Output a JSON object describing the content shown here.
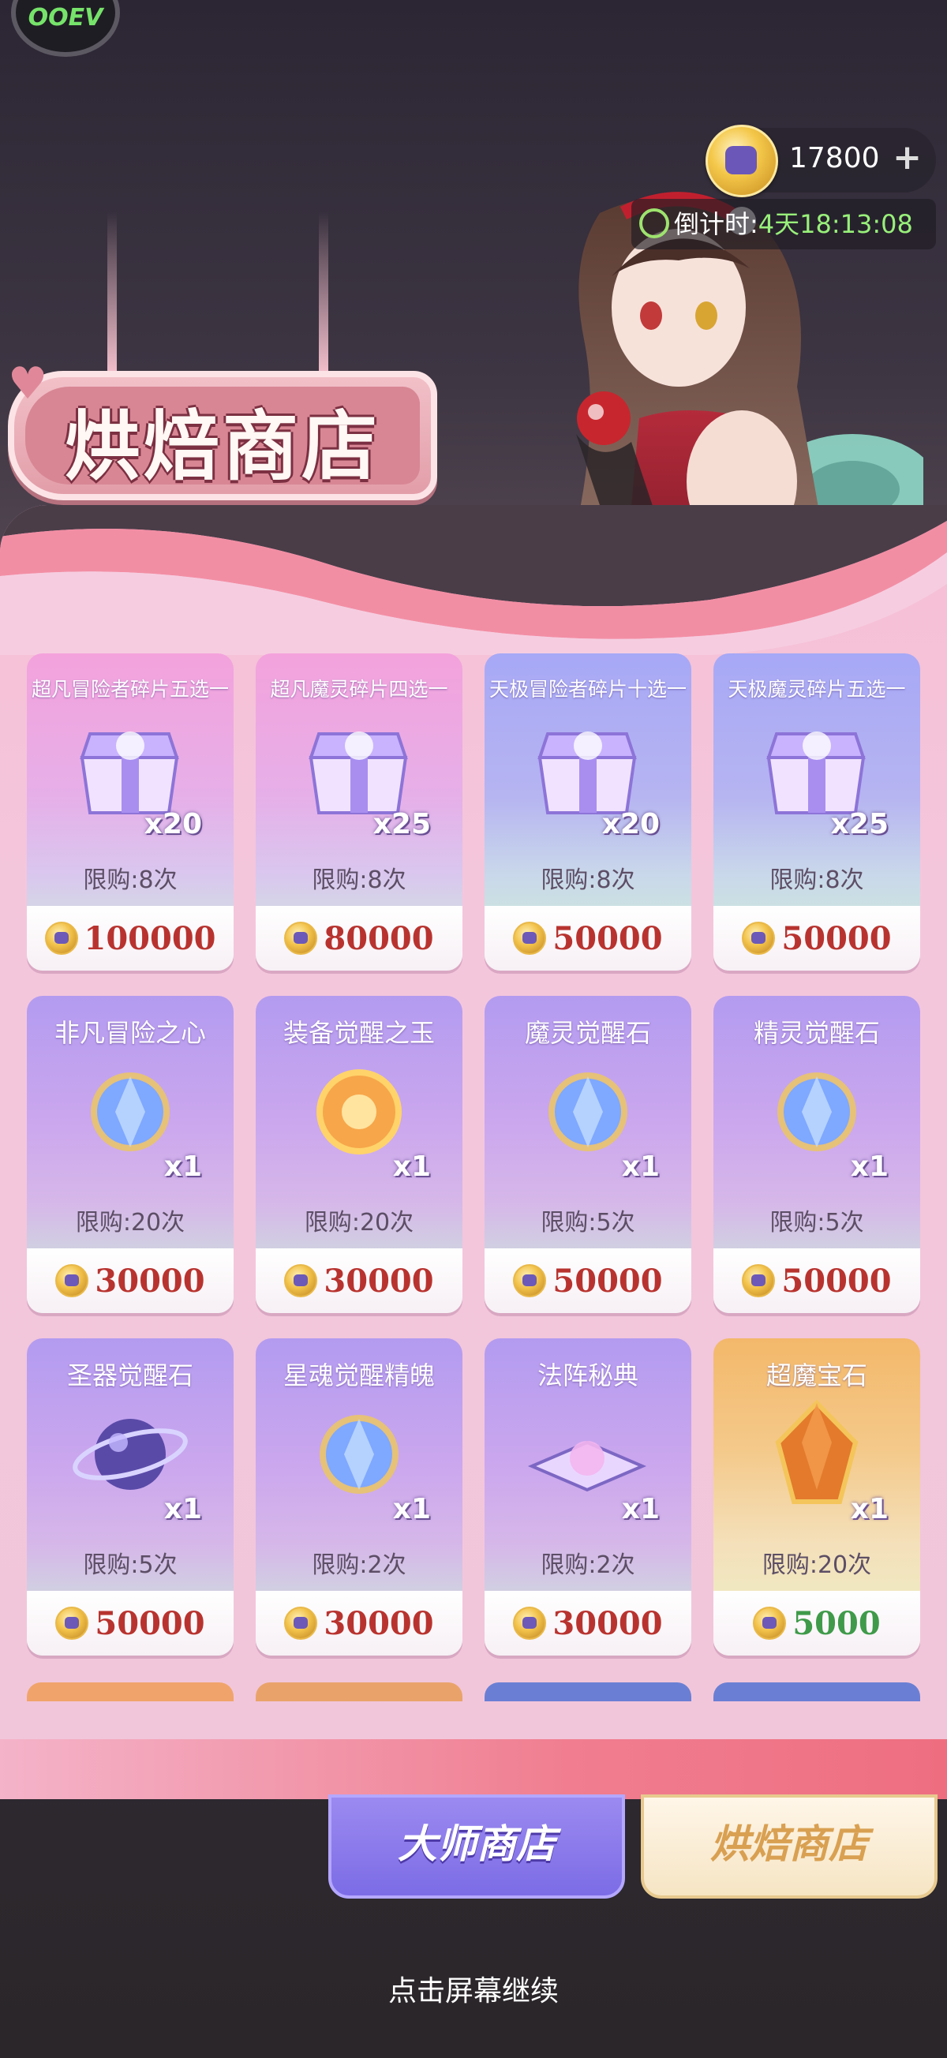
{
  "top_badge": {
    "label": "OOEV"
  },
  "currency": {
    "amount": "17800",
    "plus": "+",
    "icon": "coin-icon"
  },
  "countdown": {
    "label": "倒计时:",
    "value": "4天18:13:08"
  },
  "shop_sign": {
    "title": "烘焙商店"
  },
  "items": [
    {
      "name": "超凡冒险者碎片五选一",
      "qty": "x20",
      "limit": "限购:8次",
      "price": "100000",
      "style": "pink"
    },
    {
      "name": "超凡魔灵碎片四选一",
      "qty": "x25",
      "limit": "限购:8次",
      "price": "80000",
      "style": "pink"
    },
    {
      "name": "天极冒险者碎片十选一",
      "qty": "x20",
      "limit": "限购:8次",
      "price": "50000",
      "style": "blue"
    },
    {
      "name": "天极魔灵碎片五选一",
      "qty": "x25",
      "limit": "限购:8次",
      "price": "50000",
      "style": "blue"
    },
    {
      "name": "非凡冒险之心",
      "qty": "x1",
      "limit": "限购:20次",
      "price": "30000",
      "style": "purple"
    },
    {
      "name": "装备觉醒之玉",
      "qty": "x1",
      "limit": "限购:20次",
      "price": "30000",
      "style": "purple"
    },
    {
      "name": "魔灵觉醒石",
      "qty": "x1",
      "limit": "限购:5次",
      "price": "50000",
      "style": "purple"
    },
    {
      "name": "精灵觉醒石",
      "qty": "x1",
      "limit": "限购:5次",
      "price": "50000",
      "style": "purple"
    },
    {
      "name": "圣器觉醒石",
      "qty": "x1",
      "limit": "限购:5次",
      "price": "50000",
      "style": "purple"
    },
    {
      "name": "星魂觉醒精魄",
      "qty": "x1",
      "limit": "限购:2次",
      "price": "30000",
      "style": "purple"
    },
    {
      "name": "法阵秘典",
      "qty": "x1",
      "limit": "限购:2次",
      "price": "30000",
      "style": "purple"
    },
    {
      "name": "超魔宝石",
      "qty": "x1",
      "limit": "限购:20次",
      "price": "5000",
      "style": "gold"
    }
  ],
  "tabs": {
    "master": "大师商店",
    "baking": "烘焙商店"
  },
  "continue_hint": "点击屏幕继续",
  "colors": {
    "price_red": "#b8332f",
    "price_green": "#3f9a4a",
    "countdown_green": "#98f07a",
    "panel_pink": "#f6bfd5"
  }
}
